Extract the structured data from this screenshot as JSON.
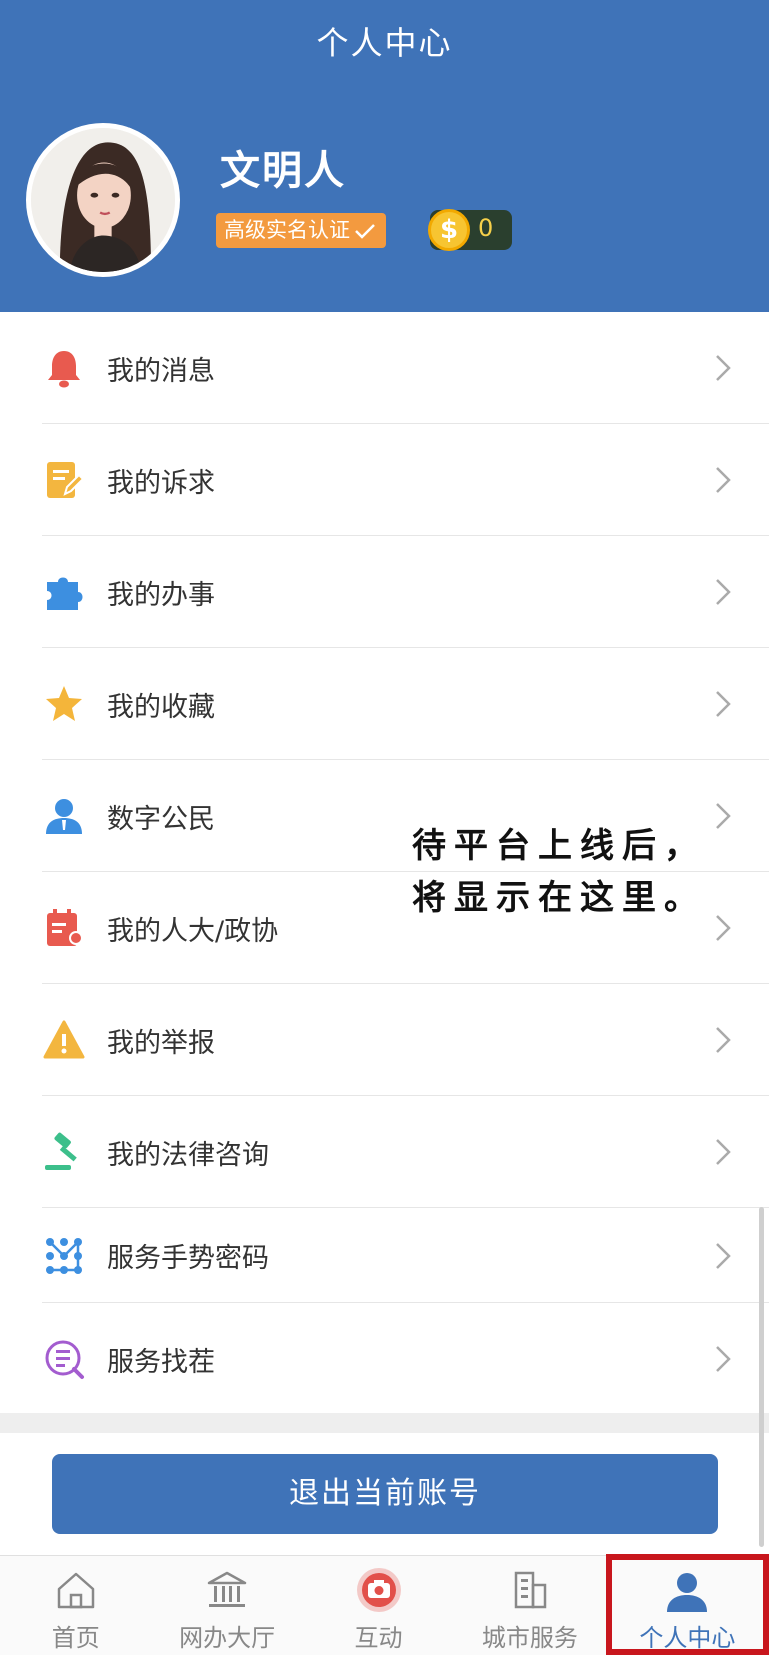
{
  "header": {
    "title": "个人中心",
    "username": "文明人",
    "certification": "高级实名认证",
    "coin_symbol": "$",
    "coin_count": "0"
  },
  "menu": [
    {
      "label": "我的消息",
      "icon": "bell-icon",
      "color": "#e85a4f"
    },
    {
      "label": "我的诉求",
      "icon": "edit-note-icon",
      "color": "#f3b63f"
    },
    {
      "label": "我的办事",
      "icon": "puzzle-icon",
      "color": "#3d8fe0"
    },
    {
      "label": "我的收藏",
      "icon": "star-icon",
      "color": "#f4b53a"
    },
    {
      "label": "数字公民",
      "icon": "user-badge-icon",
      "color": "#3d8fe0"
    },
    {
      "label": "我的人大/政协",
      "icon": "calendar-doc-icon",
      "color": "#e85a4f"
    },
    {
      "label": "我的举报",
      "icon": "warning-icon",
      "color": "#f3b63f"
    },
    {
      "label": "我的法律咨询",
      "icon": "gavel-icon",
      "color": "#3cbf8b"
    },
    {
      "label": "服务手势密码",
      "icon": "gesture-pattern-icon",
      "color": "#3d8fe0"
    },
    {
      "label": "服务找茬",
      "icon": "search-doc-icon",
      "color": "#a35ccf"
    }
  ],
  "overlay_note": {
    "line1": "待平台上线后，",
    "line2": "将显示在这里。"
  },
  "logout_label": "退出当前账号",
  "tabs": [
    {
      "label": "首页",
      "icon": "home-icon"
    },
    {
      "label": "网办大厅",
      "icon": "hall-icon"
    },
    {
      "label": "互动",
      "icon": "camera-icon"
    },
    {
      "label": "城市服务",
      "icon": "building-icon"
    },
    {
      "label": "个人中心",
      "icon": "person-icon",
      "active": true
    }
  ],
  "colors": {
    "primary": "#3f73b8",
    "badge": "#f39a3f",
    "coin": "#f7c531",
    "highlight_border": "#c8161d"
  }
}
